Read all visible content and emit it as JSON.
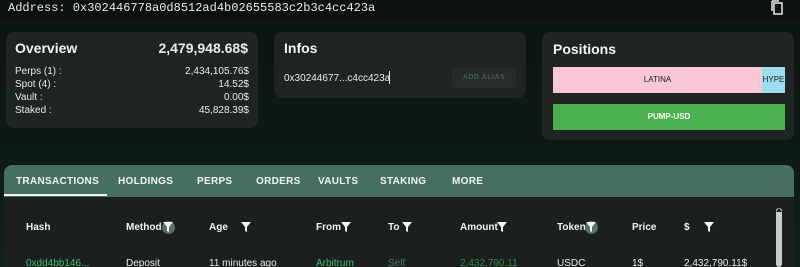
{
  "address_bar": {
    "text": "Address: 0x302446778a0d8512ad4b02655583c2b3c4cc423a"
  },
  "overview": {
    "title": "Overview",
    "total": "2,479,948.68$",
    "rows": [
      {
        "label": "Perps (1) :",
        "value": "2,434,105.76$"
      },
      {
        "label": "Spot (4) :",
        "value": "14.52$"
      },
      {
        "label": "Vault :",
        "value": "0.00$"
      },
      {
        "label": "Staked :",
        "value": "45,828.39$"
      }
    ]
  },
  "infos": {
    "title": "Infos",
    "address_short": "0x30244677...c4cc423a",
    "alias_button": "ADD ALIAS"
  },
  "positions": {
    "title": "Positions",
    "segments": [
      {
        "label": "LATINA",
        "share": 0.9,
        "color": "#f9c7d6"
      },
      {
        "label": "HYPE",
        "share": 0.1,
        "color": "#9edcf0"
      }
    ],
    "button": "PUMP-USD"
  },
  "tabs": [
    "TRANSACTIONS",
    "HOLDINGS",
    "PERPS",
    "ORDERS",
    "VAULTS",
    "STAKING",
    "MORE"
  ],
  "table": {
    "headers": [
      "Hash",
      "Method",
      "Age",
      "From",
      "To",
      "Amount",
      "Token",
      "Price",
      "$"
    ],
    "row": {
      "hash": "0xdd4bb146...",
      "method": "Deposit",
      "age": "11 minutes ago",
      "from": "Arbitrum",
      "to": "Self",
      "amount": "2,432,790.11",
      "token": "USDC",
      "price": "1$",
      "usd": "2,432,790.11$"
    }
  },
  "colors": {
    "accent_green": "#4caf50",
    "tab_bar": "#466e63",
    "link_green": "#38c27a"
  }
}
